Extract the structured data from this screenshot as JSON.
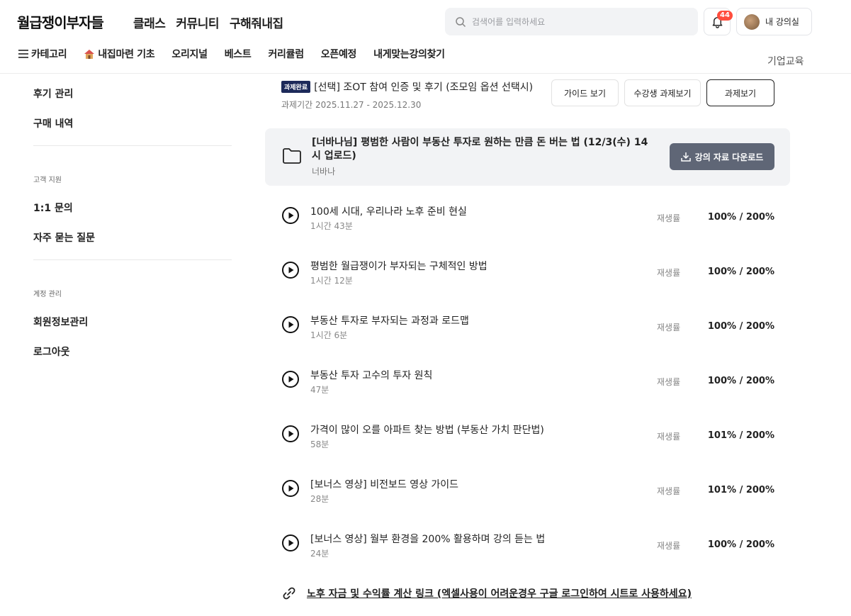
{
  "header": {
    "logo": "월급쟁이부자들",
    "nav": [
      "클래스",
      "커뮤니티",
      "구해줘내집"
    ],
    "search_placeholder": "검색어를 입력하세요",
    "notification_count": "44",
    "my_class_label": "내 강의실",
    "subnav": [
      "카테고리",
      "내집마련 기초",
      "오리지널",
      "베스트",
      "커리큘럼",
      "오픈예정",
      "내게맞는강의찾기"
    ],
    "corporate": "기업교육"
  },
  "sidebar": {
    "items_top": [
      "후기 관리",
      "구매 내역"
    ],
    "section_support": "고객 지원",
    "items_support": [
      "1:1 문의",
      "자주 묻는 질문"
    ],
    "section_account": "계정 관리",
    "items_account": [
      "회원정보관리",
      "로그아웃"
    ]
  },
  "task": {
    "badge": "과제완료",
    "title": "[선택] 조OT 참여 인증 및 후기 (조모임 옵션 선택시)",
    "period": "과제기간 2025.11.27 - 2025.12.30",
    "buttons": [
      "가이드 보기",
      "수강생 과제보기",
      "과제보기"
    ]
  },
  "folder": {
    "title": "[너바나님] 평범한 사람이 부동산 투자로 원하는 만큼 돈 버는 법 (12/3(수) 14시 업로드)",
    "author": "너바나",
    "download_label": "강의 자료 다운로드"
  },
  "lessons": [
    {
      "title": "100세 시대, 우리나라 노후 준비 현실",
      "duration": "1시간 43분",
      "rate_label": "재생률",
      "rate": "100% / 200%"
    },
    {
      "title": "평범한 월급쟁이가 부자되는 구체적인 방법",
      "duration": "1시간 12분",
      "rate_label": "재생률",
      "rate": "100% / 200%"
    },
    {
      "title": "부동산 투자로 부자되는 과정과 로드맵",
      "duration": "1시간 6분",
      "rate_label": "재생률",
      "rate": "100% / 200%"
    },
    {
      "title": "부동산 투자 고수의 투자 원칙",
      "duration": "47분",
      "rate_label": "재생률",
      "rate": "100% / 200%"
    },
    {
      "title": "가격이 많이 오를 아파트 찾는 방법 (부동산 가치 판단법)",
      "duration": "58분",
      "rate_label": "재생률",
      "rate": "101% / 200%"
    },
    {
      "title": "[보너스 영상] 비전보드 영상 가이드",
      "duration": "28분",
      "rate_label": "재생률",
      "rate": "101% / 200%"
    },
    {
      "title": "[보너스 영상] 월부 환경을 200% 활용하며 강의 듣는 법",
      "duration": "24분",
      "rate_label": "재생률",
      "rate": "100% / 200%"
    }
  ],
  "link": {
    "text": "노후 자금 및 수익률 계산 링크 (엑셀사용이 어려운경우 구글 로그인하여 시트로 사용하세요)"
  }
}
